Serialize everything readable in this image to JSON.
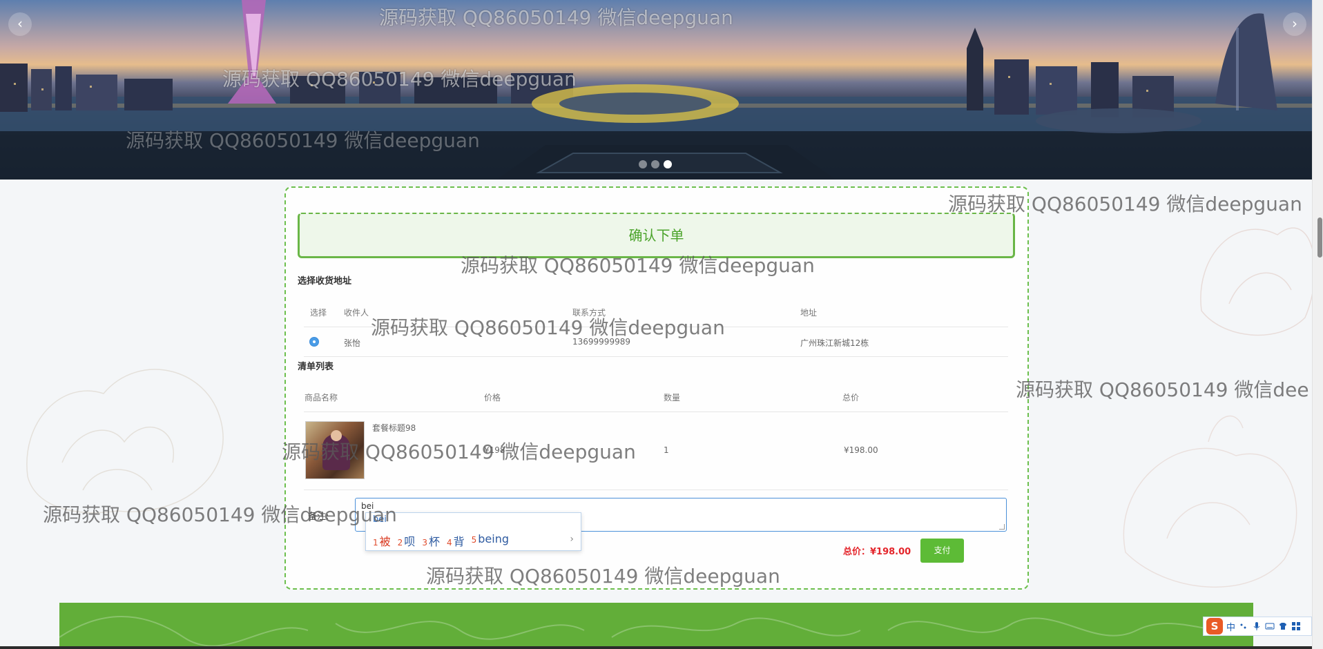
{
  "banner": {
    "prev_icon": "chevron-left-icon",
    "next_icon": "chevron-right-icon",
    "prev_glyph": "‹",
    "next_glyph": "›",
    "slide_count": 3,
    "active_slide": 3
  },
  "confirm": {
    "title": "确认下单"
  },
  "address": {
    "section_title": "选择收货地址",
    "columns": [
      "选择",
      "收件人",
      "联系方式",
      "地址"
    ],
    "rows": [
      {
        "selected": true,
        "recipient": "张怡",
        "phone": "13699999989",
        "address": "广州珠江新城12栋"
      }
    ]
  },
  "cart": {
    "section_title": "清单列表",
    "columns": [
      "商品名称",
      "价格",
      "数量",
      "总价"
    ],
    "items": [
      {
        "name": "套餐标题98",
        "price": "¥198",
        "quantity": "1",
        "total": "¥198.00",
        "image_icon": "product-photo"
      }
    ]
  },
  "note": {
    "label": "备注:",
    "value": "bei"
  },
  "ime_popup": {
    "composition": "bei",
    "candidates": [
      {
        "num": "1",
        "text": "被"
      },
      {
        "num": "2",
        "text": "呗"
      },
      {
        "num": "3",
        "text": "杯"
      },
      {
        "num": "4",
        "text": "背"
      },
      {
        "num": "5",
        "text": "being"
      }
    ],
    "next_glyph": "›"
  },
  "summary": {
    "total_text": "总价：¥198.00",
    "pay_label": "支付"
  },
  "ime_tray": {
    "logo": "S",
    "mode": "中",
    "icons": [
      "punctuation-icon",
      "microphone-icon",
      "keyboard-icon",
      "skin-icon",
      "grid-icon"
    ]
  },
  "watermark": {
    "text": "源码获取 QQ86050149 微信deepguan",
    "text_cut": "源码获取 QQ86050149 微信dee"
  },
  "colors": {
    "brand_green": "#5dbb36",
    "price_red": "#e4252b",
    "footer_green": "#62ae39",
    "radio_blue": "#4a9ce6"
  }
}
